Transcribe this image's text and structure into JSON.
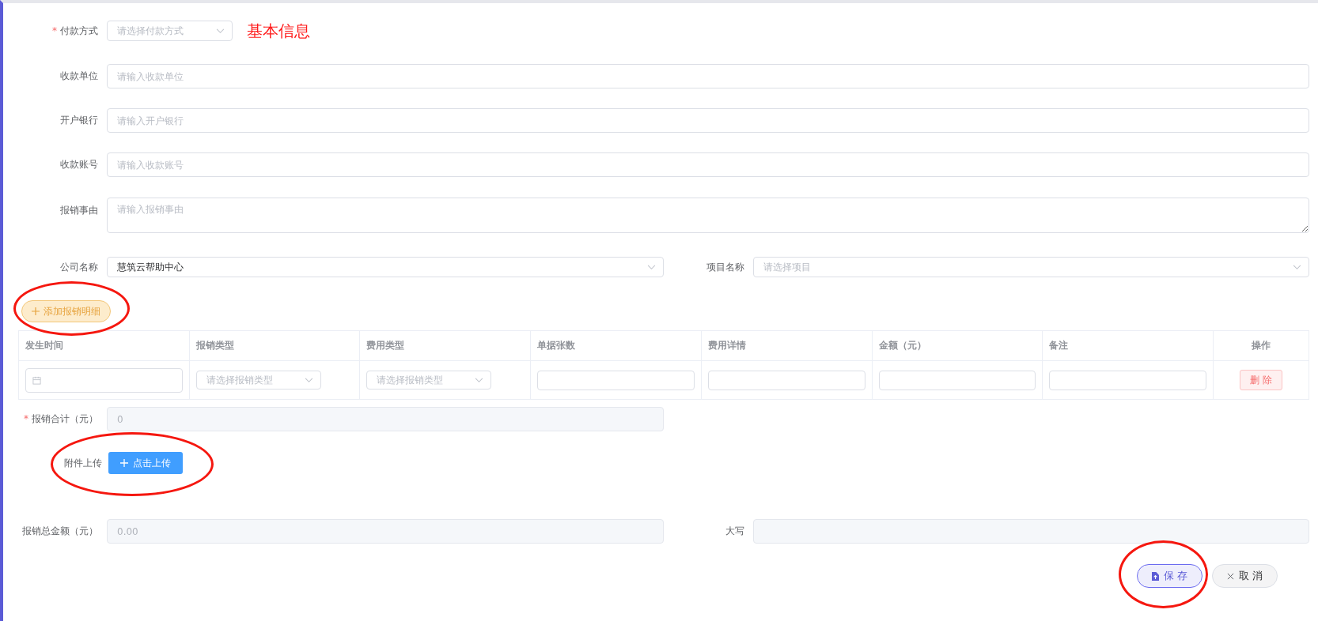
{
  "payment_method": {
    "label": "付款方式",
    "required_mark": "*",
    "placeholder": "请选择付款方式"
  },
  "section_title": "基本信息",
  "text_fields": [
    {
      "label": "收款单位",
      "placeholder": "请输入收款单位"
    },
    {
      "label": "开户银行",
      "placeholder": "请输入开户银行"
    },
    {
      "label": "收款账号",
      "placeholder": "请输入收款账号"
    }
  ],
  "reason": {
    "label": "报销事由",
    "placeholder": "请输入报销事由"
  },
  "company": {
    "label": "公司名称",
    "value": "慧筑云帮助中心"
  },
  "project": {
    "label": "项目名称",
    "placeholder": "请选择项目"
  },
  "add_detail_button": {
    "label": "添加报销明细",
    "circled": true
  },
  "detail_table": {
    "columns": [
      "发生时间",
      "报销类型",
      "费用类型",
      "单据张数",
      "费用详情",
      "金额（元）",
      "备注",
      "操作"
    ],
    "rows": [
      {
        "cells": [
          {
            "kind": "date"
          },
          {
            "kind": "select",
            "placeholder": "请选择报销类型"
          },
          {
            "kind": "select",
            "placeholder": "请选择报销类型"
          },
          {
            "kind": "input"
          },
          {
            "kind": "input"
          },
          {
            "kind": "input"
          },
          {
            "kind": "input"
          },
          {
            "kind": "button",
            "label": "删 除"
          }
        ]
      }
    ]
  },
  "subtotal": {
    "label": "报销合计（元）",
    "required_mark": "*",
    "value": "0"
  },
  "attachment": {
    "label": "附件上传",
    "button": "点击上传",
    "circled": true
  },
  "total_amount": {
    "label": "报销总金额（元）",
    "value": "0.00"
  },
  "uppercase": {
    "label": "大写"
  },
  "actions": [
    {
      "kind": "save",
      "label": "保 存",
      "circled": true
    },
    {
      "kind": "cancel",
      "label": "取 消",
      "circled": false
    }
  ]
}
